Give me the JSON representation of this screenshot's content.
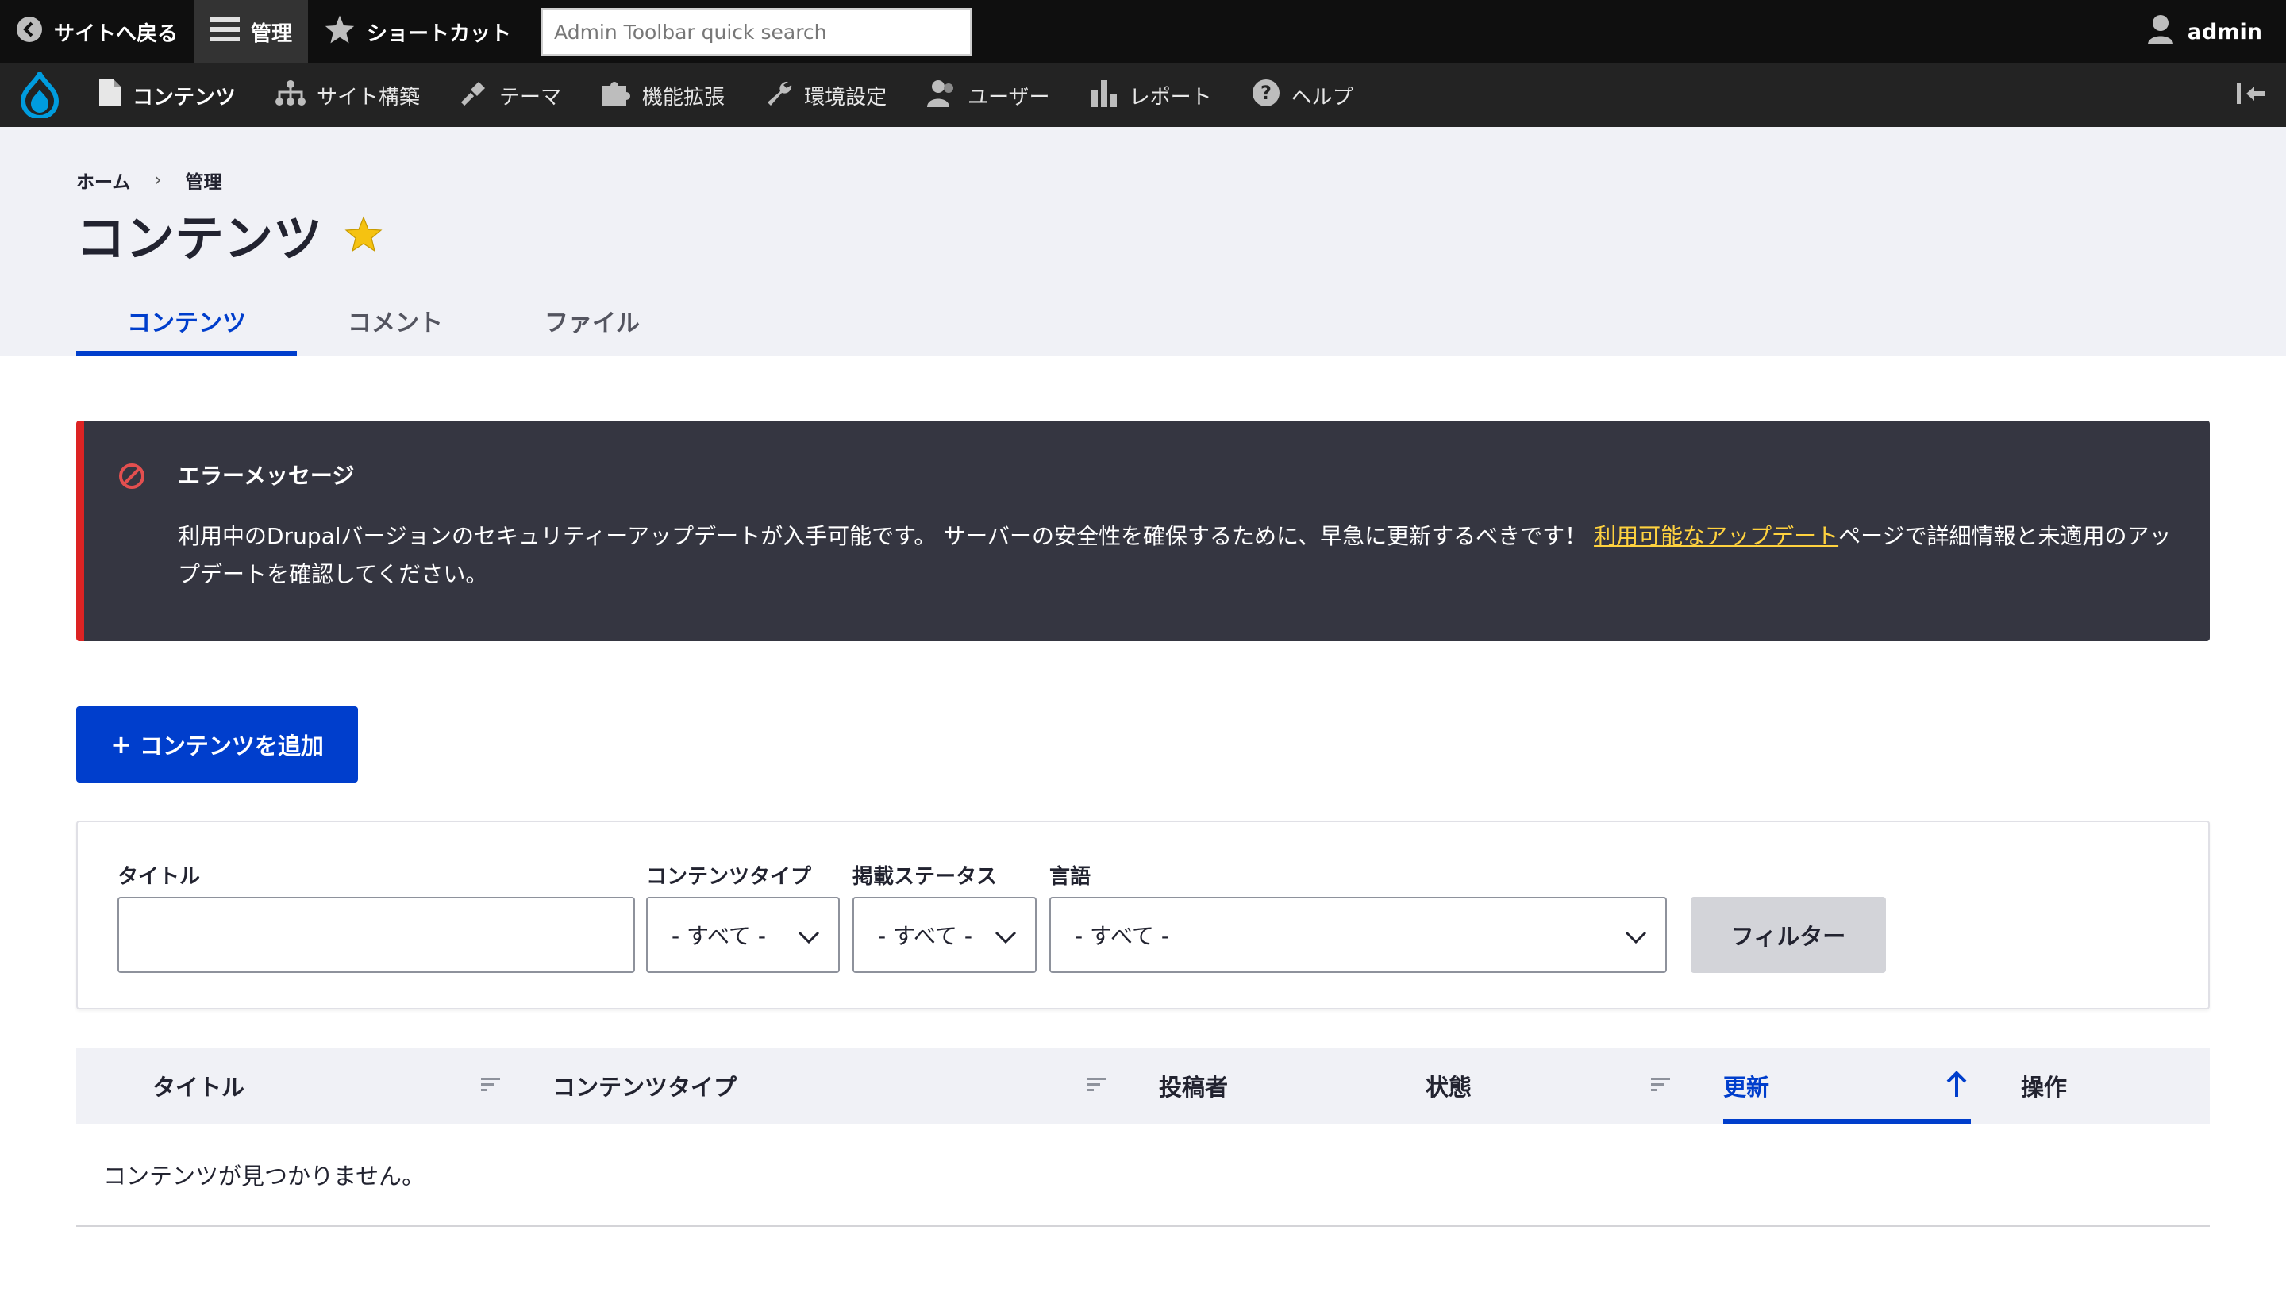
{
  "toolbar": {
    "back_label": "サイトへ戻る",
    "manage_label": "管理",
    "shortcuts_label": "ショートカット",
    "search_placeholder": "Admin Toolbar quick search",
    "user_label": "admin"
  },
  "tray": {
    "items": [
      {
        "label": "コンテンツ",
        "icon": "file-icon"
      },
      {
        "label": "サイト構築",
        "icon": "sitemap-icon"
      },
      {
        "label": "テーマ",
        "icon": "paintbrush-icon"
      },
      {
        "label": "機能拡張",
        "icon": "puzzle-icon"
      },
      {
        "label": "環境設定",
        "icon": "wrench-icon"
      },
      {
        "label": "ユーザー",
        "icon": "people-icon"
      },
      {
        "label": "レポート",
        "icon": "bar-chart-icon"
      },
      {
        "label": "ヘルプ",
        "icon": "help-icon"
      }
    ]
  },
  "breadcrumb": {
    "home": "ホーム",
    "separator": "›",
    "current": "管理"
  },
  "page": {
    "title": "コンテンツ"
  },
  "tabs": [
    {
      "label": "コンテンツ",
      "active": true
    },
    {
      "label": "コメント",
      "active": false
    },
    {
      "label": "ファイル",
      "active": false
    }
  ],
  "message": {
    "title": "エラーメッセージ",
    "body_before": "利用中のDrupalバージョンのセキュリティーアップデートが入手可能です。 サーバーの安全性を確保するために、早急に更新するべきです！ ",
    "link_text": "利用可能なアップデート",
    "body_after": "ページで詳細情報と未適用のアップデートを確認してください。"
  },
  "add_button": {
    "plus": "+",
    "label": "コンテンツを追加"
  },
  "filters": {
    "title_label": "タイトル",
    "title_value": "",
    "type_label": "コンテンツタイプ",
    "type_value": "- すべて -",
    "status_label": "掲載ステータス",
    "status_value": "- すべて -",
    "language_label": "言語",
    "language_value": "- すべて -",
    "submit_label": "フィルター"
  },
  "table": {
    "headers": {
      "title": "タイトル",
      "type": "コンテンツタイプ",
      "author": "投稿者",
      "status": "状態",
      "updated": "更新",
      "operations": "操作"
    },
    "empty": "コンテンツが見つかりません。"
  },
  "colors": {
    "accent": "#003ecc",
    "error": "#dc2323",
    "link_in_message": "#ffd23f",
    "star": "#f5c211",
    "drupal_logo": "#009cde"
  }
}
